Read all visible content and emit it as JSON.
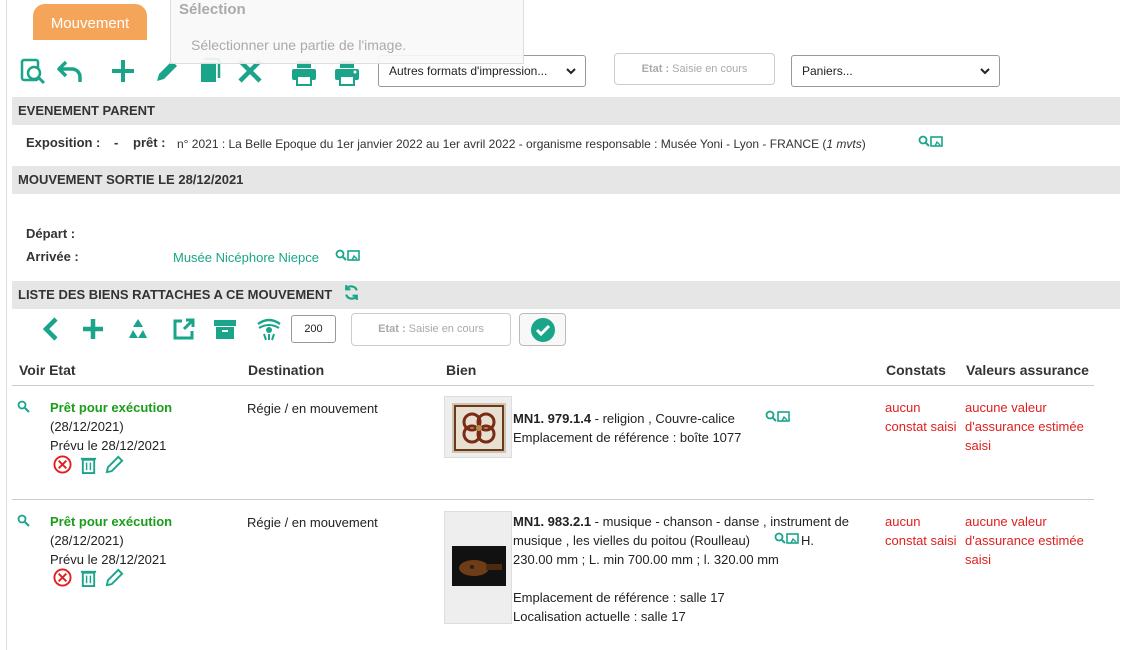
{
  "tab": {
    "label": "Mouvement"
  },
  "selection": {
    "title": "Sélection",
    "hint": "Sélectionner une partie de l'image."
  },
  "toolbar": {
    "print_formats": "Autres formats d'impression...",
    "state_label": "Etat :",
    "state_value": "Saisie en cours",
    "baskets": "Paniers..."
  },
  "parent": {
    "header": "EVENEMENT PARENT",
    "exposition_label": "Exposition :",
    "exposition_value": "-",
    "pret_label": "prêt :",
    "pret_value": "n° 2021 : La Belle Epoque du 1er janvier 2022 au 1er avril 2022 - organisme responsable : Musée Yoni - Lyon - FRANCE (",
    "pret_mvts": "1 mvts",
    "pret_close": ")"
  },
  "movement": {
    "header": "MOUVEMENT SORTIE LE 28/12/2021",
    "depart_label": "Départ :",
    "arrivee_label": "Arrivée :",
    "arrivee_value": "Musée Nicéphore Niepce"
  },
  "list": {
    "header": "LISTE DES BIENS RATTACHES A CE MOUVEMENT",
    "count": "200",
    "state_label": "Etat :",
    "state_value": "Saisie en cours"
  },
  "table": {
    "columns": [
      "Voir Etat",
      "Destination",
      "Bien",
      "Constats",
      "Valeurs assurance"
    ],
    "rows": [
      {
        "status": "Prêt pour exécution",
        "date": "(28/12/2021)",
        "planned": "Prévu le 28/12/2021",
        "destination": "Régie / en mouvement",
        "inv": "MN1. 979.1.4",
        "desc_line1": " - religion , Couvre-calice",
        "desc_line2": "",
        "desc_line3": "",
        "emplacement": "Emplacement de référence : boîte 1077",
        "localisation": "",
        "constats": [
          "aucun",
          "constat saisi"
        ],
        "valeurs": [
          "aucune valeur",
          "d'assurance estimée",
          "saisi"
        ]
      },
      {
        "status": "Prêt pour exécution",
        "date": "(28/12/2021)",
        "planned": "Prévu le 28/12/2021",
        "destination": "Régie / en mouvement",
        "inv": "MN1. 983.2.1",
        "desc_line1": " - musique - chanson - danse , instrument de",
        "desc_line2": "musique , les vielles du poitou (Roulleau)",
        "desc_line2b": "H.",
        "desc_line3": "230.00 mm ; L. min 700.00 mm ; l. 320.00 mm",
        "emplacement": "Emplacement de référence : salle 17",
        "localisation": "Localisation actuelle : salle 17",
        "constats": [
          "aucun",
          "constat saisi"
        ],
        "valeurs": [
          "aucune valeur",
          "d'assurance estimée",
          "saisi"
        ]
      }
    ]
  },
  "colors": {
    "teal": "#1aa58a",
    "green": "#1a9d1a",
    "red": "#e0201e",
    "tab": "#f5a55a"
  }
}
